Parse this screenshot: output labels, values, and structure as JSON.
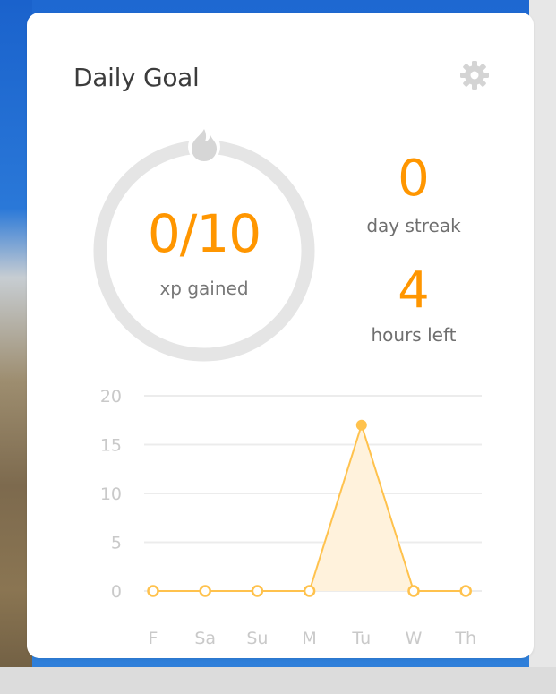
{
  "daily_goal": {
    "title": "Daily Goal",
    "settings_icon": "gear-icon",
    "progress_icon": "flame-icon",
    "xp": {
      "value": "0/10",
      "label": "xp gained",
      "progress": 0.0
    },
    "streak": {
      "value": "0",
      "label": "day streak"
    },
    "time_left": {
      "value": "4",
      "label": "hours left"
    }
  },
  "colors": {
    "accent": "#ff9600",
    "ring": "#e5e5e5",
    "chart_line": "#ffc24d",
    "chart_fill": "#fff2dc",
    "grid": "#ececec",
    "muted_text": "#c9c9c9"
  },
  "chart_data": {
    "type": "area",
    "categories": [
      "F",
      "Sa",
      "Su",
      "M",
      "Tu",
      "W",
      "Th"
    ],
    "values": [
      0,
      0,
      0,
      0,
      17,
      0,
      0
    ],
    "yticks": [
      "20",
      "15",
      "10",
      "5",
      "0"
    ],
    "ylim": [
      0,
      20
    ],
    "grid": true,
    "title": "",
    "xlabel": "",
    "ylabel": ""
  }
}
